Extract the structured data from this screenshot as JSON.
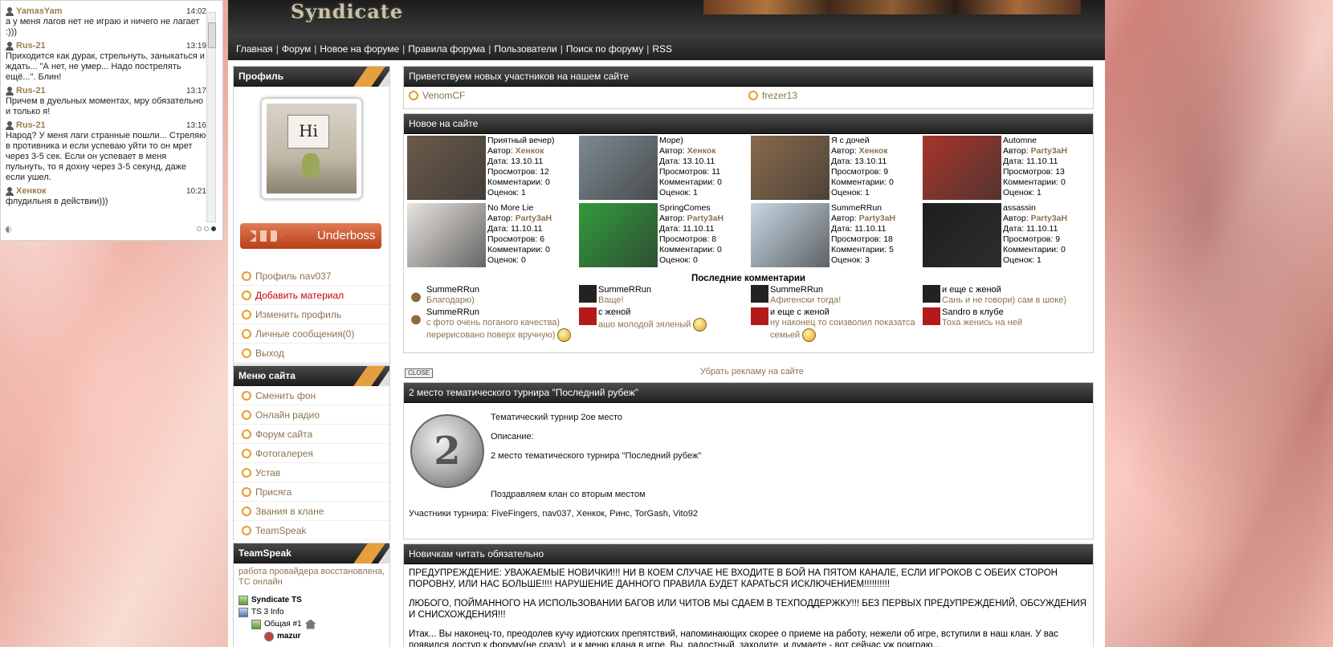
{
  "chat": {
    "messages": [
      {
        "user": "YamasYam",
        "time": "14:02",
        "text": "а у меня лагов нет не играю и ничего не лагает :)))"
      },
      {
        "user": "Rus-21",
        "time": "13:19",
        "text": "Приходится как дурак, стрельнуть, заныкаться и ждать... \"А нет, не умер... Надо пострелять ещё...\". Блин!"
      },
      {
        "user": "Rus-21",
        "time": "13:17",
        "text": "Причем в дуельных моментах, мру обязательно и только я!"
      },
      {
        "user": "Rus-21",
        "time": "13:16",
        "text": "Народ? У меня лаги странные пошли... Стреляю в противника и если успеваю уйти то он мрет через 3-5 сек. Если он успевает в меня пульнуть, то я дохну через 3-5 секунд, даже если ушел."
      },
      {
        "user": "Хенкок",
        "time": "10:21",
        "text": "флудильня в действии)))"
      }
    ]
  },
  "logo": "Syndicate",
  "nav": [
    "Главная",
    "Форум",
    "Новое на форуме",
    "Правила форума",
    "Пользователи",
    "Поиск по форуму",
    "RSS"
  ],
  "profile": {
    "title": "Профиль",
    "avatar_text": "Hi",
    "rank": "Underboss",
    "links": [
      "Профиль nav037",
      "Добавить материал",
      "Изменить профиль",
      "Личные сообщения(0)",
      "Выход"
    ]
  },
  "site_menu": {
    "title": "Меню сайта",
    "items": [
      "Сменить фон",
      "Онлайн радио",
      "Форум сайта",
      "Фотогалерея",
      "Устав",
      "Присяга",
      "Звания в клане",
      "TeamSpeak"
    ]
  },
  "teamspeak": {
    "title": "TeamSpeak",
    "notice": "работа провайдера восстановлена, ТС онлайн",
    "tree": [
      "Syndicate TS",
      "TS 3 Info",
      "Общая #1",
      "mazur"
    ]
  },
  "welcome": {
    "title": "Приветствуем новых участников на нашем сайте",
    "users": [
      "VenomCF",
      "frezer13"
    ]
  },
  "new_on_site": {
    "title": "Новое на сайте",
    "labels": {
      "author": "Автор:",
      "date": "Дата:",
      "views": "Просмотров:",
      "comments": "Комментарии:",
      "rating": "Оценок:"
    },
    "photos": [
      {
        "name": "Приятный вечер)",
        "author": "Хенкок",
        "date": "13.10.11",
        "views": "12",
        "comments": "0",
        "rating": "1",
        "color": "#6b5a4a"
      },
      {
        "name": "Море)",
        "author": "Хенкок",
        "date": "13.10.11",
        "views": "11",
        "comments": "0",
        "rating": "1",
        "color": "#7d8a92"
      },
      {
        "name": "Я с дочей",
        "author": "Хенкок",
        "date": "13.10.11",
        "views": "9",
        "comments": "0",
        "rating": "1",
        "color": "#8a6a4a"
      },
      {
        "name": "Automne",
        "author": "Party3aH",
        "date": "11.10.11",
        "views": "13",
        "comments": "0",
        "rating": "1",
        "color": "#a8342a"
      },
      {
        "name": "No More Lie",
        "author": "Party3aH",
        "date": "11.10.11",
        "views": "6",
        "comments": "0",
        "rating": "0",
        "color": "#e8e4e0"
      },
      {
        "name": "SpringComes",
        "author": "Party3aH",
        "date": "11.10.11",
        "views": "8",
        "comments": "0",
        "rating": "0",
        "color": "#2f9a3a"
      },
      {
        "name": "SummeRRun",
        "author": "Party3aH",
        "date": "11.10.11",
        "views": "18",
        "comments": "5",
        "rating": "3",
        "color": "#c8d8e4"
      },
      {
        "name": "assassin",
        "author": "Party3aH",
        "date": "11.10.11",
        "views": "9",
        "comments": "0",
        "rating": "1",
        "color": "#1e1e1e"
      }
    ],
    "comments_title": "Последние комментарии",
    "comments": [
      {
        "title": "SummeRRun",
        "text": "Благодарю)",
        "avatar": "lamp",
        "smile": false
      },
      {
        "title": "SummeRRun",
        "text": "Ваще!",
        "avatar": "dark",
        "smile": false
      },
      {
        "title": "SummeRRun",
        "text": "Афигенски тогда!",
        "avatar": "dark",
        "smile": false
      },
      {
        "title": "и еще с женой",
        "text": "Сань и не говори) сам в шоке)",
        "avatar": "dark",
        "smile": false
      },
      {
        "title": "SummeRRun",
        "text": "с фото очень поганого качества) перерисовано поверх вручную)",
        "avatar": "lamp",
        "smile": true
      },
      {
        "title": "с женой",
        "text": "ашо молодой зяленый",
        "avatar": "red",
        "smile": true
      },
      {
        "title": "и еще с женой",
        "text": "ну наконец то соизволил показатса семьей",
        "avatar": "red",
        "smile": true
      },
      {
        "title": "Sandro в клубе",
        "text": "Тоха женись на ней",
        "avatar": "red",
        "smile": false
      }
    ]
  },
  "ad": {
    "close": "CLOSE",
    "remove": "Убрать рекламу на сайте"
  },
  "tournament": {
    "title": "2 место тематического турнира \"Последний рубеж\"",
    "medal_number": "2",
    "heading": "Тематический турнир 2ое место",
    "desc_label": "Описание:",
    "desc": "2 место тематического турнира \"Последний рубеж\"",
    "congrats": "Поздравляем клан со вторым местом",
    "participants": "Участники турнира: FiveFingers, nav037, Хенкок, Ринс, TorGash, Vito92"
  },
  "newbies": {
    "title": "Новичкам читать обязательно",
    "p1": "ПРЕДУПРЕЖДЕНИЕ: УВАЖАЕМЫЕ НОВИЧКИ!!! НИ В КОЕМ СЛУЧАЕ НЕ ВХОДИТЕ В БОЙ НА ПЯТОМ КАНАЛЕ, ЕСЛИ ИГРОКОВ С ОБЕИХ СТОРОН ПОРОВНУ, ИЛИ НАС БОЛЬШЕ!!!! НАРУШЕНИЕ ДАННОГО ПРАВИЛА БУДЕТ КАРАТЬСЯ ИСКЛЮЧЕНИЕМ!!!!!!!!!!",
    "p2": "ЛЮБОГО, ПОЙМАННОГО НА ИСПОЛЬЗОВАНИИ БАГОВ ИЛИ ЧИТОВ МЫ СДАЕМ В ТЕХПОДДЕРЖКУ!!! БЕЗ ПЕРВЫХ ПРЕДУПРЕЖДЕНИЙ, ОБСУЖДЕНИЯ И СНИСХОЖДЕНИЯ!!!",
    "p3": "Итак... Вы наконец-то, преодолев кучу идиотских препятствий, напоминающих скорее о приеме на работу, нежели об игре, вступили в наш клан. У вас появился доступ к форуму(не сразу), и к меню клана в игре. Вы, радостный, заходите, и думаете - вот сейчас уж поиграю..."
  }
}
